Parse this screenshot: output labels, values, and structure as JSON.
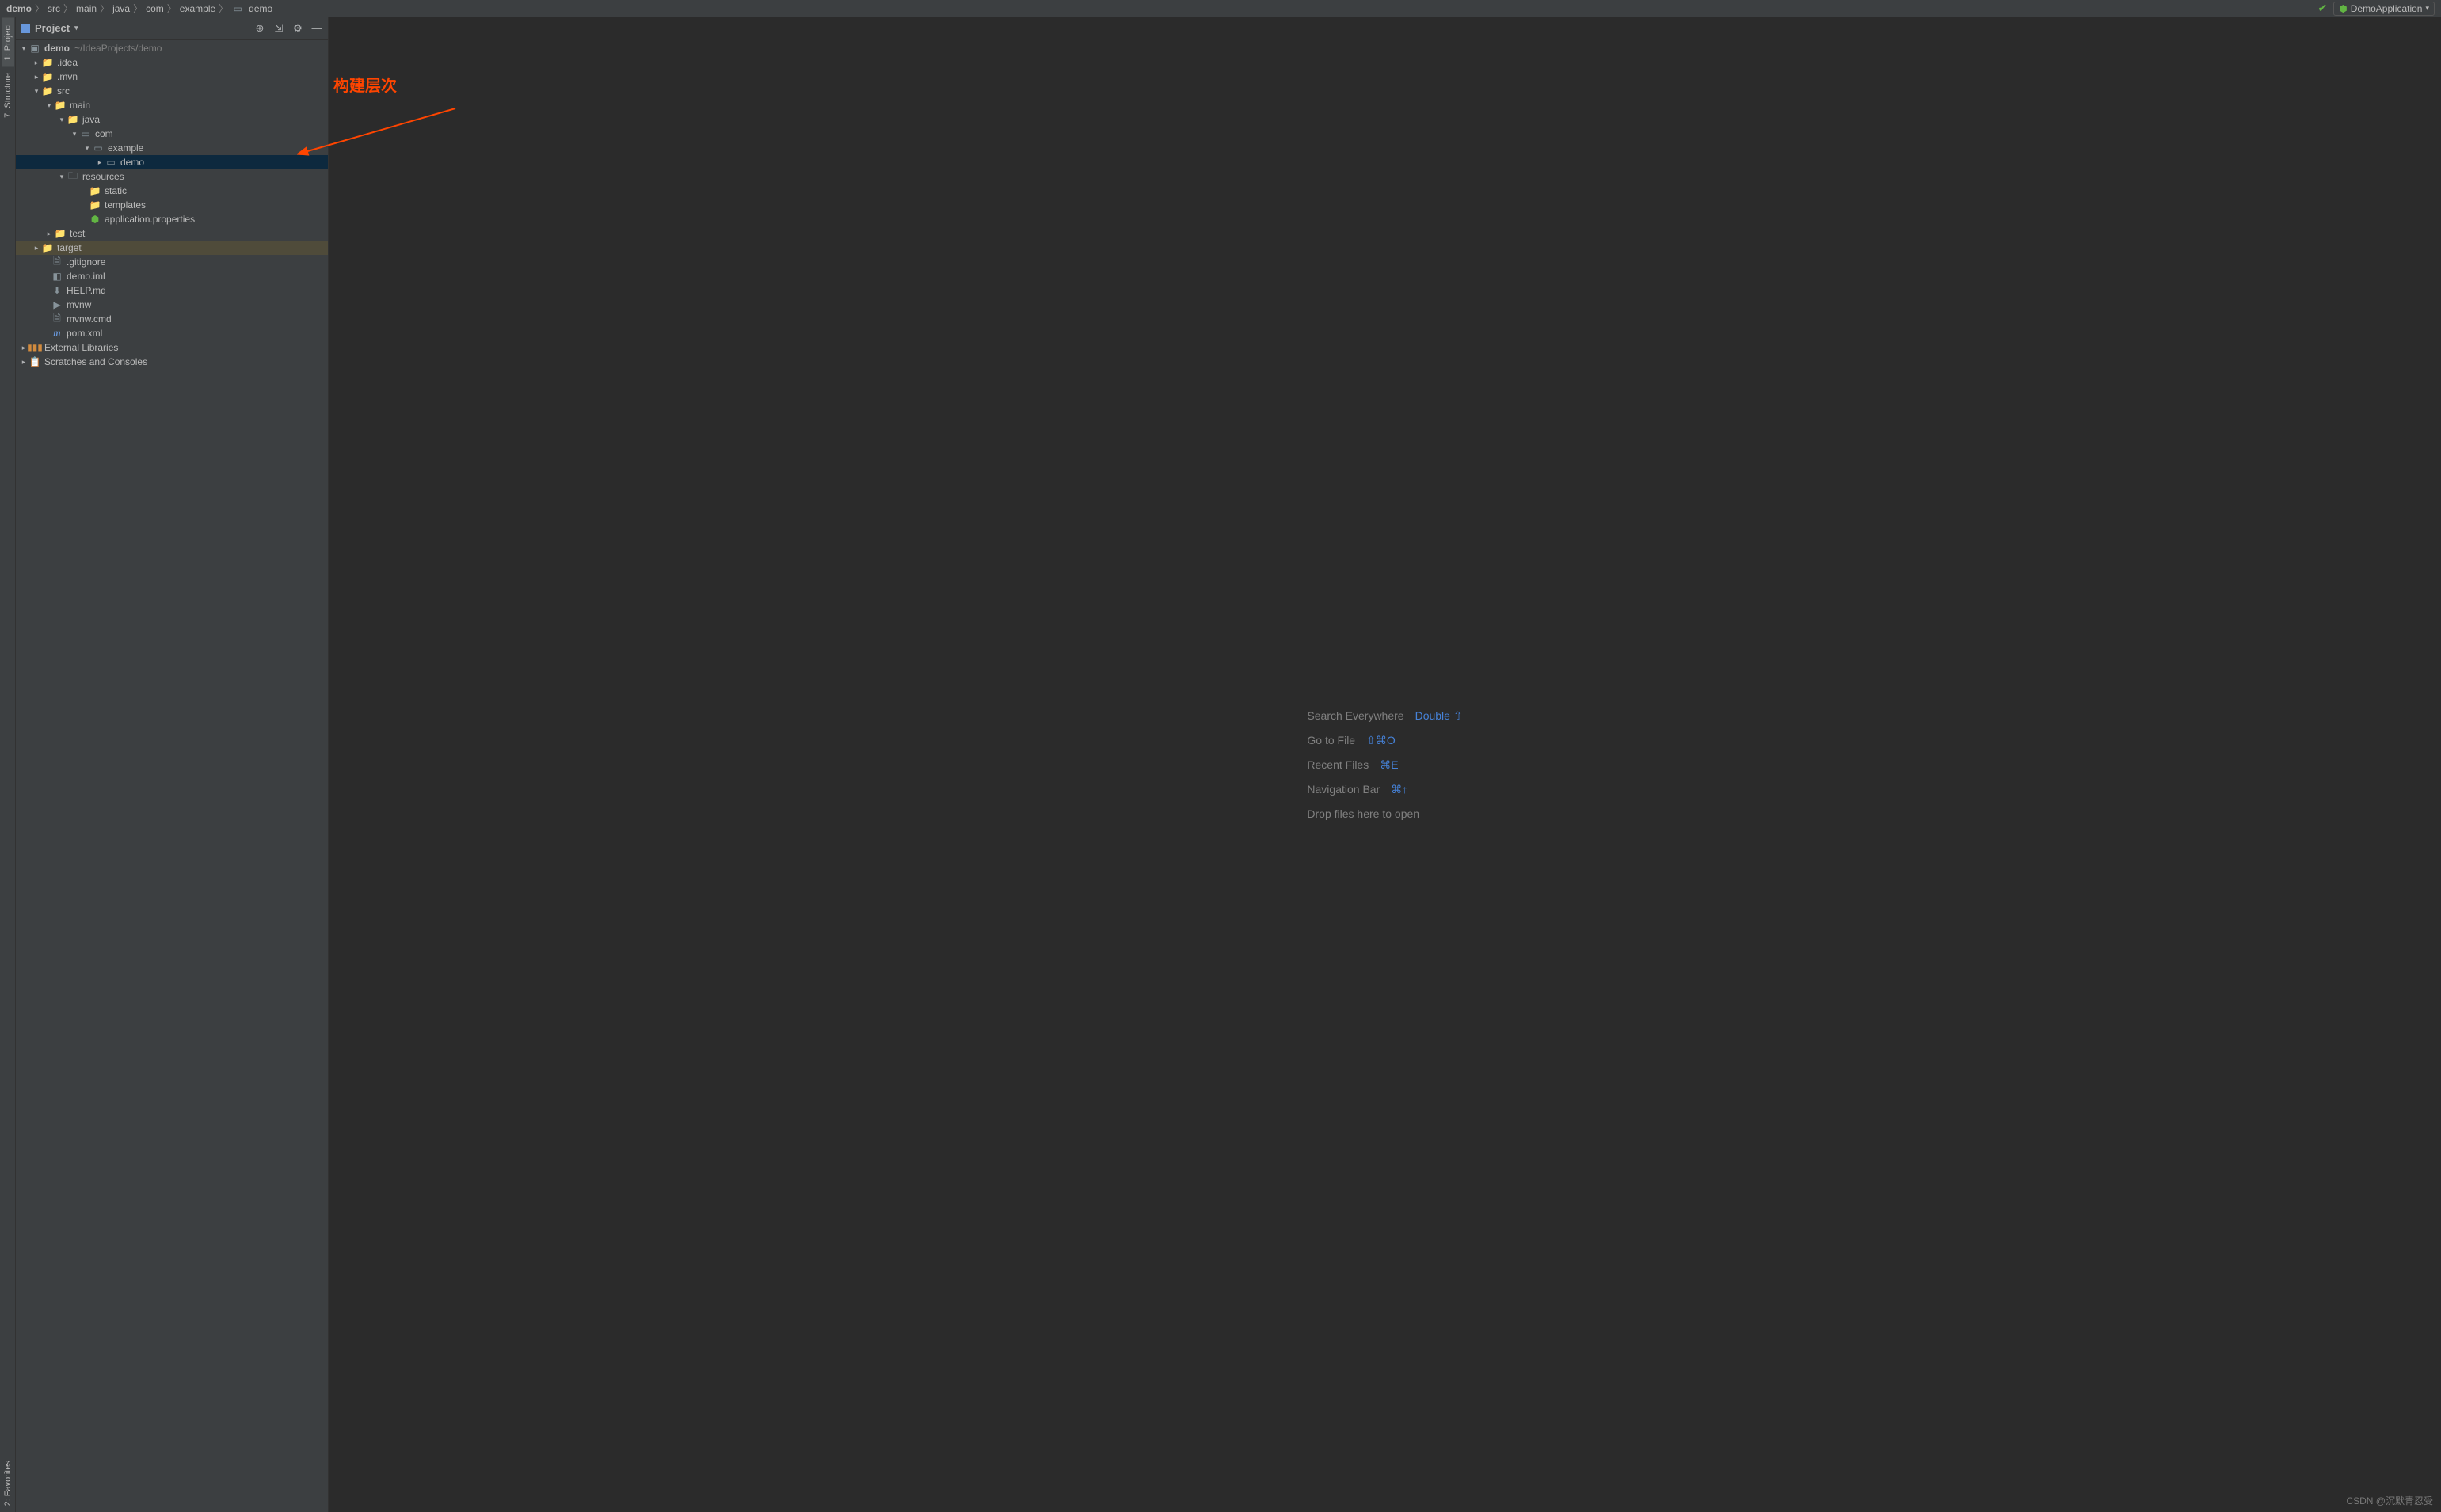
{
  "breadcrumbs": [
    "demo",
    "src",
    "main",
    "java",
    "com",
    "example",
    "demo"
  ],
  "runConfig": {
    "label": "DemoApplication"
  },
  "sidebar": {
    "title": "Project",
    "tree": {
      "root": {
        "label": "demo",
        "hint": "~/IdeaProjects/demo"
      },
      "idea": ".idea",
      "mvn": ".mvn",
      "src": "src",
      "main": "main",
      "java": "java",
      "com": "com",
      "example": "example",
      "demo_pkg": "demo",
      "resources": "resources",
      "static": "static",
      "templates": "templates",
      "app_props": "application.properties",
      "test": "test",
      "target": "target",
      "gitignore": ".gitignore",
      "demo_iml": "demo.iml",
      "help_md": "HELP.md",
      "mvnw": "mvnw",
      "mvnw_cmd": "mvnw.cmd",
      "pom": "pom.xml",
      "ext_libs": "External Libraries",
      "scratches": "Scratches and Consoles"
    }
  },
  "gutterTabs": {
    "project": "1: Project",
    "structure": "7: Structure",
    "favorites": "2: Favorites"
  },
  "annotation": {
    "text": "构建层次"
  },
  "hints": {
    "search": {
      "label": "Search Everywhere",
      "key": "Double ⇧"
    },
    "goto": {
      "label": "Go to File",
      "key": "⇧⌘O"
    },
    "recent": {
      "label": "Recent Files",
      "key": "⌘E"
    },
    "navbar": {
      "label": "Navigation Bar",
      "key": "⌘↑"
    },
    "drop": {
      "label": "Drop files here to open"
    }
  },
  "watermark": "CSDN @沉默青忍受"
}
